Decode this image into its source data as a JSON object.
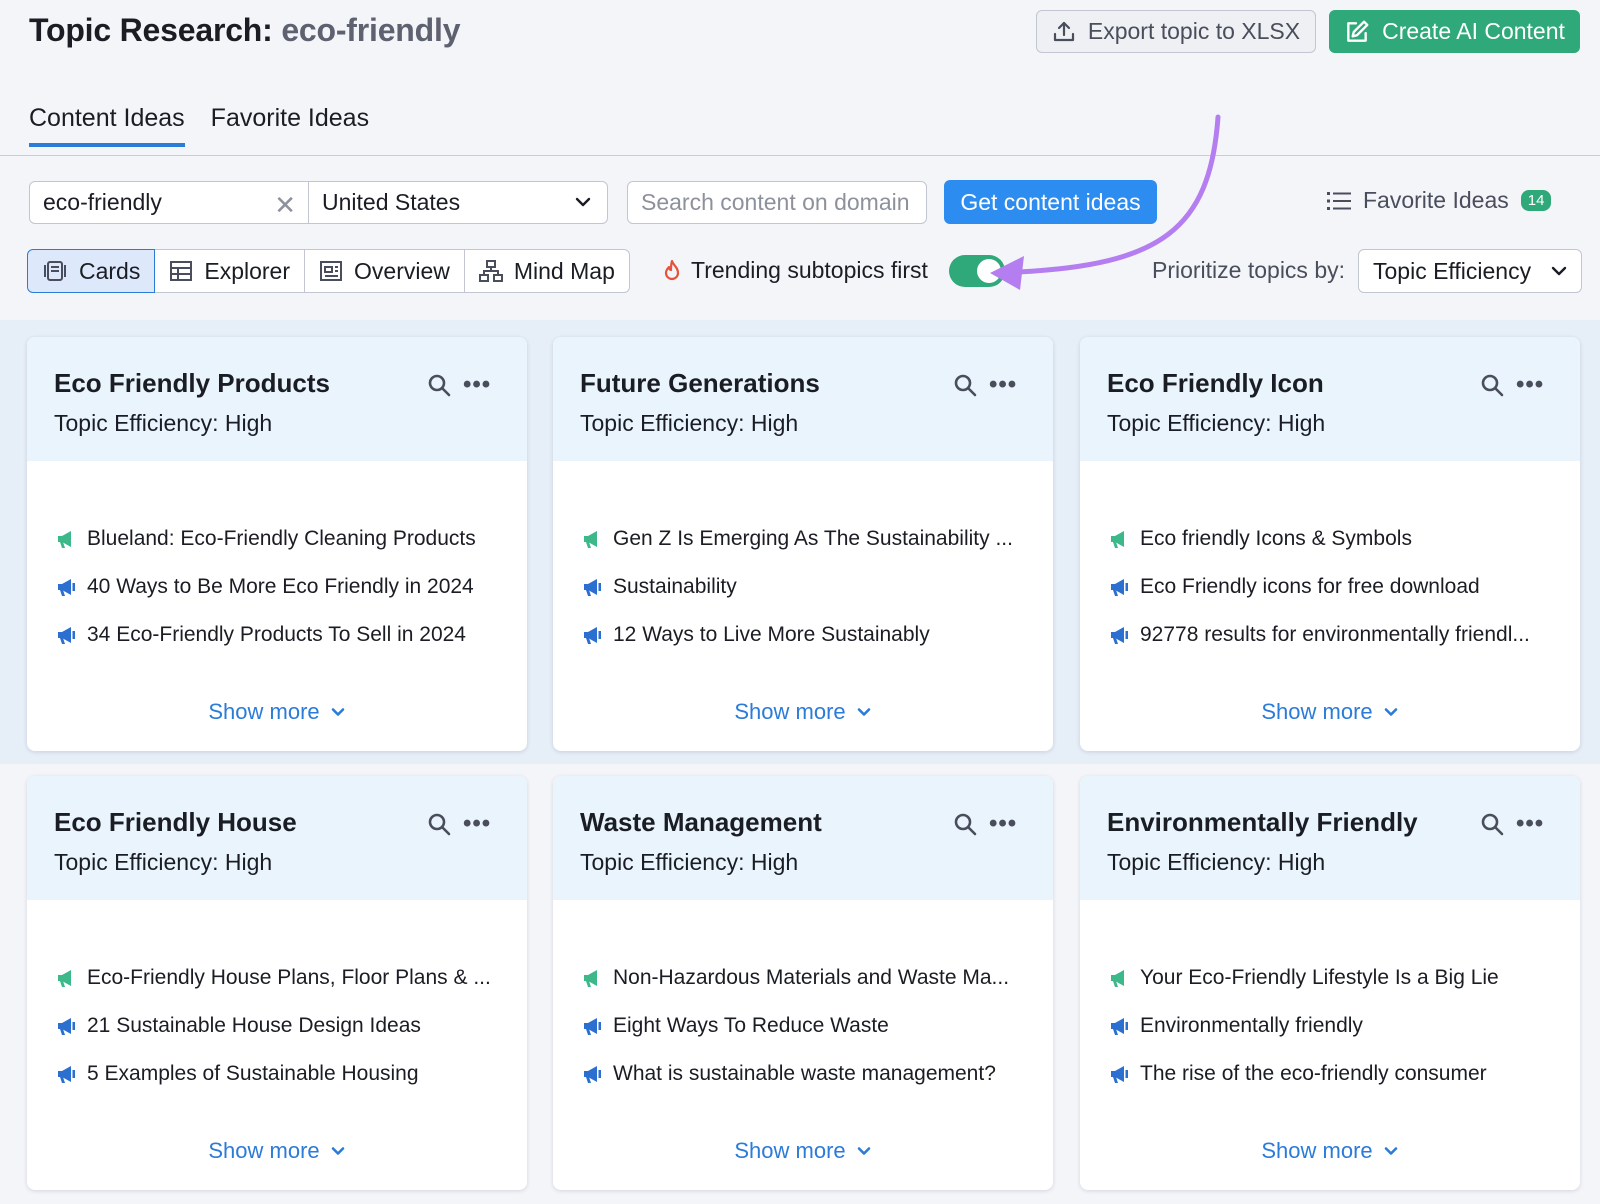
{
  "header": {
    "title_prefix": "Topic Research:",
    "title_keyword": "eco-friendly",
    "export_label": "Export topic to XLSX",
    "create_label": "Create AI Content"
  },
  "tabs": [
    {
      "label": "Content Ideas",
      "active": true
    },
    {
      "label": "Favorite Ideas",
      "active": false
    }
  ],
  "search": {
    "keyword_value": "eco-friendly",
    "country": "United States",
    "domain_placeholder": "Search content on domain",
    "get_ideas_label": "Get content ideas",
    "favorite_label": "Favorite Ideas",
    "favorite_count": "14"
  },
  "views": [
    {
      "label": "Cards",
      "icon": "cards-icon",
      "active": true
    },
    {
      "label": "Explorer",
      "icon": "table-icon",
      "active": false
    },
    {
      "label": "Overview",
      "icon": "overview-icon",
      "active": false
    },
    {
      "label": "Mind Map",
      "icon": "mindmap-icon",
      "active": false
    }
  ],
  "trending": {
    "label": "Trending subtopics first",
    "enabled": true
  },
  "prioritize": {
    "label": "Prioritize topics by:",
    "value": "Topic Efficiency"
  },
  "colors": {
    "accent": "#2b7bd9",
    "green": "#2fa87a",
    "arrow": "#b57ef0"
  },
  "cards": [
    {
      "title": "Eco Friendly Products",
      "subtitle": "Topic Efficiency: High",
      "ideas": [
        {
          "text": "Blueland: Eco-Friendly Cleaning Products",
          "trending": true
        },
        {
          "text": "40 Ways to Be More Eco Friendly in 2024",
          "trending": false
        },
        {
          "text": "34 Eco-Friendly Products To Sell in 2024",
          "trending": false
        }
      ],
      "show_more": "Show more"
    },
    {
      "title": "Future Generations",
      "subtitle": "Topic Efficiency: High",
      "ideas": [
        {
          "text": "Gen Z Is Emerging As The Sustainability ...",
          "trending": true
        },
        {
          "text": "Sustainability",
          "trending": false
        },
        {
          "text": "12 Ways to Live More Sustainably",
          "trending": false
        }
      ],
      "show_more": "Show more"
    },
    {
      "title": "Eco Friendly Icon",
      "subtitle": "Topic Efficiency: High",
      "ideas": [
        {
          "text": "Eco friendly Icons & Symbols",
          "trending": true
        },
        {
          "text": "Eco Friendly icons for free download",
          "trending": false
        },
        {
          "text": "92778 results for environmentally friendl...",
          "trending": false
        }
      ],
      "show_more": "Show more"
    },
    {
      "title": "Eco Friendly House",
      "subtitle": "Topic Efficiency: High",
      "ideas": [
        {
          "text": "Eco-Friendly House Plans, Floor Plans & ...",
          "trending": true
        },
        {
          "text": "21 Sustainable House Design Ideas",
          "trending": false
        },
        {
          "text": "5 Examples of Sustainable Housing",
          "trending": false
        }
      ],
      "show_more": "Show more"
    },
    {
      "title": "Waste Management",
      "subtitle": "Topic Efficiency: High",
      "ideas": [
        {
          "text": "Non-Hazardous Materials and Waste Ma...",
          "trending": true
        },
        {
          "text": "Eight Ways To Reduce Waste",
          "trending": false
        },
        {
          "text": "What is sustainable waste management?",
          "trending": false
        }
      ],
      "show_more": "Show more"
    },
    {
      "title": "Environmentally Friendly",
      "subtitle": "Topic Efficiency: High",
      "ideas": [
        {
          "text": "Your Eco-Friendly Lifestyle Is a Big Lie",
          "trending": true
        },
        {
          "text": "Environmentally friendly",
          "trending": false
        },
        {
          "text": "The rise of the eco-friendly consumer",
          "trending": false
        }
      ],
      "show_more": "Show more"
    }
  ]
}
